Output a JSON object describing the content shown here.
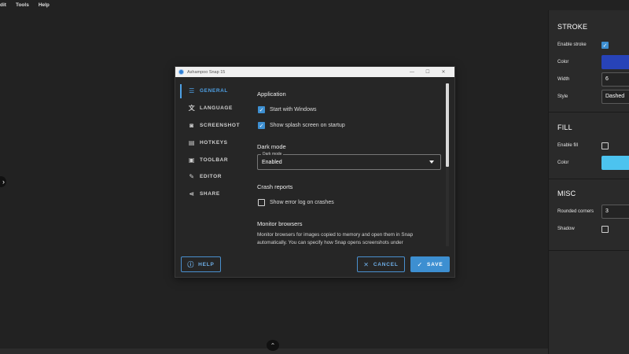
{
  "menubar": {
    "items": [
      "dit",
      "Tools",
      "Help"
    ]
  },
  "dialog": {
    "title": "Ashampoo Snap 15",
    "nav": [
      {
        "label": "GENERAL",
        "icon": "sliders-icon",
        "glyph": "☰",
        "active": true
      },
      {
        "label": "LANGUAGE",
        "icon": "translate-icon",
        "glyph": "文",
        "active": false
      },
      {
        "label": "SCREENSHOT",
        "icon": "camera-icon",
        "glyph": "◙",
        "active": false
      },
      {
        "label": "HOTKEYS",
        "icon": "keyboard-icon",
        "glyph": "▤",
        "active": false
      },
      {
        "label": "TOOLBAR",
        "icon": "toolbox-icon",
        "glyph": "▣",
        "active": false
      },
      {
        "label": "EDITOR",
        "icon": "pencil-icon",
        "glyph": "✎",
        "active": false
      },
      {
        "label": "SHARE",
        "icon": "share-icon",
        "glyph": "⋖",
        "active": false
      }
    ],
    "application": {
      "heading": "Application",
      "start_with_windows": {
        "label": "Start with Windows",
        "checked": true
      },
      "splash_screen": {
        "label": "Show splash screen on startup",
        "checked": true
      }
    },
    "dark_mode": {
      "heading": "Dark mode",
      "field_label": "Dark mode",
      "value": "Enabled"
    },
    "crash_reports": {
      "heading": "Crash reports",
      "error_log": {
        "label": "Show error log on crashes",
        "checked": false
      }
    },
    "monitor_browsers": {
      "heading": "Monitor browsers",
      "description": "Monitor browsers for images copied to memory and open them in Snap automatically. You can specify how Snap opens screenshots under"
    },
    "buttons": {
      "help": "HELP",
      "cancel": "CANCEL",
      "save": "SAVE"
    }
  },
  "right_panel": {
    "stroke": {
      "title": "STROKE",
      "enable_label": "Enable stroke",
      "enabled": true,
      "color_label": "Color",
      "color": "#2743b8",
      "width_label": "Width",
      "width": "6",
      "style_label": "Style",
      "style": "Dashed"
    },
    "fill": {
      "title": "FILL",
      "enable_label": "Enable fill",
      "enabled": false,
      "color_label": "Color",
      "color": "#4cc3ef"
    },
    "misc": {
      "title": "MISC",
      "rounded_label": "Rounded corners",
      "rounded": "3",
      "shadow_label": "Shadow",
      "shadow": false
    }
  }
}
